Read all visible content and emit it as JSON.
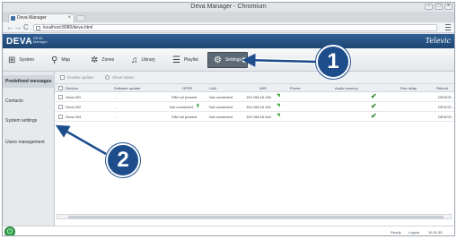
{
  "browser": {
    "window_title": "Deva Manager - Chromium",
    "tab_label": "Deva Manager",
    "tab_close": "×",
    "url": "localhost:8080/deva.html",
    "back": "←",
    "forward": "→",
    "reload": "C"
  },
  "app": {
    "brand": "DEVA",
    "brand_sub": "DEVA Manager",
    "logo": "Televic"
  },
  "nav": {
    "tabs": [
      {
        "label": "System",
        "icon": "network-icon",
        "glyph": "⊞"
      },
      {
        "label": "Map",
        "icon": "map-pin-icon",
        "glyph": "⚲"
      },
      {
        "label": "Zones",
        "icon": "zones-icon",
        "glyph": "✲"
      },
      {
        "label": "Library",
        "icon": "music-note-icon",
        "glyph": "♫"
      },
      {
        "label": "Playlist",
        "icon": "playlist-icon",
        "glyph": "☰"
      },
      {
        "label": "Settings",
        "icon": "gear-icon",
        "glyph": "⚙"
      }
    ]
  },
  "sidebar": {
    "items": [
      {
        "label": "Predefined messages"
      },
      {
        "label": "Contacts"
      },
      {
        "label": "System settings"
      },
      {
        "label": "Users management"
      }
    ]
  },
  "subtoolbar": {
    "buttons": [
      "Enable update",
      "Show status"
    ]
  },
  "table": {
    "columns": [
      "Devices",
      "Software update",
      "GPRS",
      "LAN",
      "WiFi",
      "Phone",
      "Audio memory",
      "Run delay",
      "Reboot"
    ],
    "rows": [
      {
        "name": "Deva 001",
        "update": "-",
        "gprs": "SIM not present",
        "lan": "Not connected",
        "wifi": "192.168.16.156",
        "ok": true,
        "reboot": "DEVICE..."
      },
      {
        "name": "Deva 002",
        "update": "-",
        "gprs": "Not connected",
        "lan": "Not connected",
        "wifi": "192.168.16.162",
        "ok": true,
        "reboot": "DEVICE..."
      },
      {
        "name": "Deva 003",
        "update": "-",
        "gprs": "SIM not present",
        "lan": "Not connected",
        "wifi": "192.168.16.164",
        "ok": true,
        "reboot": "DEVICE..."
      }
    ]
  },
  "status": {
    "state": "Ready",
    "logout": "Logout",
    "time": "16:31:35"
  },
  "callouts": [
    "1",
    "2"
  ],
  "colors": {
    "header_blue": "#1e4672",
    "callout_blue": "#1e4d8c",
    "ok_green": "#2f8a2f"
  }
}
